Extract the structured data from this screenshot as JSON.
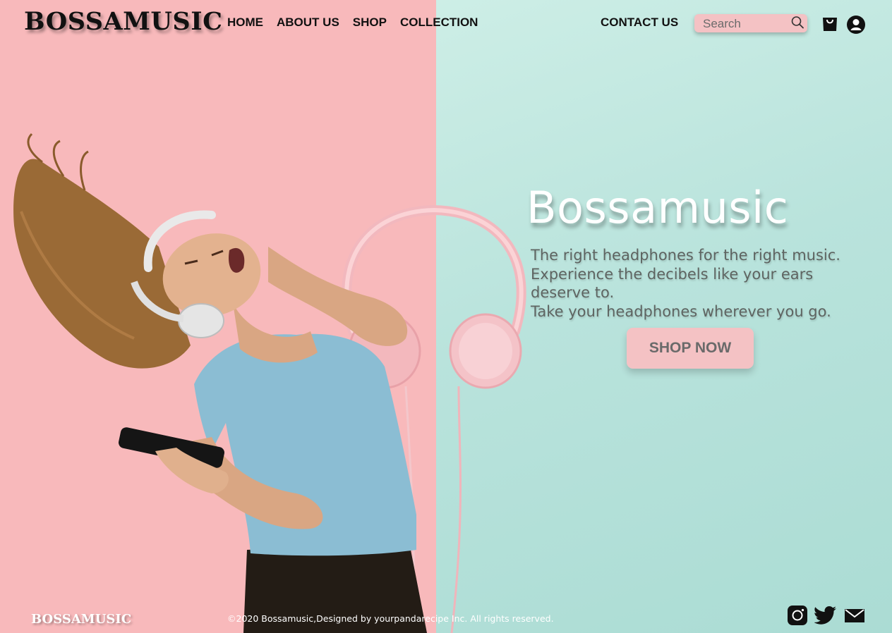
{
  "brand": {
    "logo": "BOSSAMUSIC"
  },
  "nav": {
    "items": [
      {
        "label": "HOME"
      },
      {
        "label": "ABOUT US"
      },
      {
        "label": "SHOP"
      },
      {
        "label": "COLLECTION"
      }
    ],
    "contact": "CONTACT US"
  },
  "search": {
    "placeholder": "Search",
    "value": ""
  },
  "icons": [
    "search-icon",
    "shopping-bag-icon",
    "user-icon",
    "instagram-icon",
    "twitter-icon",
    "mail-icon"
  ],
  "hero": {
    "title": "Bossamusic",
    "lines": [
      "The right headphones for the right music.",
      "Experience the decibels like your ears",
      "deserve to.",
      "Take your headphones wherever you go."
    ],
    "cta": "SHOP NOW"
  },
  "footer": {
    "logo": "BOSSAMUSIC",
    "copyright": "©2020 Bossamusic,Designed by yourpandarecipe Inc. All rights reserved."
  },
  "colors": {
    "left_bg": "#f8b9bb",
    "right_bg": "#bfe6df",
    "accent_pink": "#f4c2c4",
    "text_dark": "#111111"
  }
}
